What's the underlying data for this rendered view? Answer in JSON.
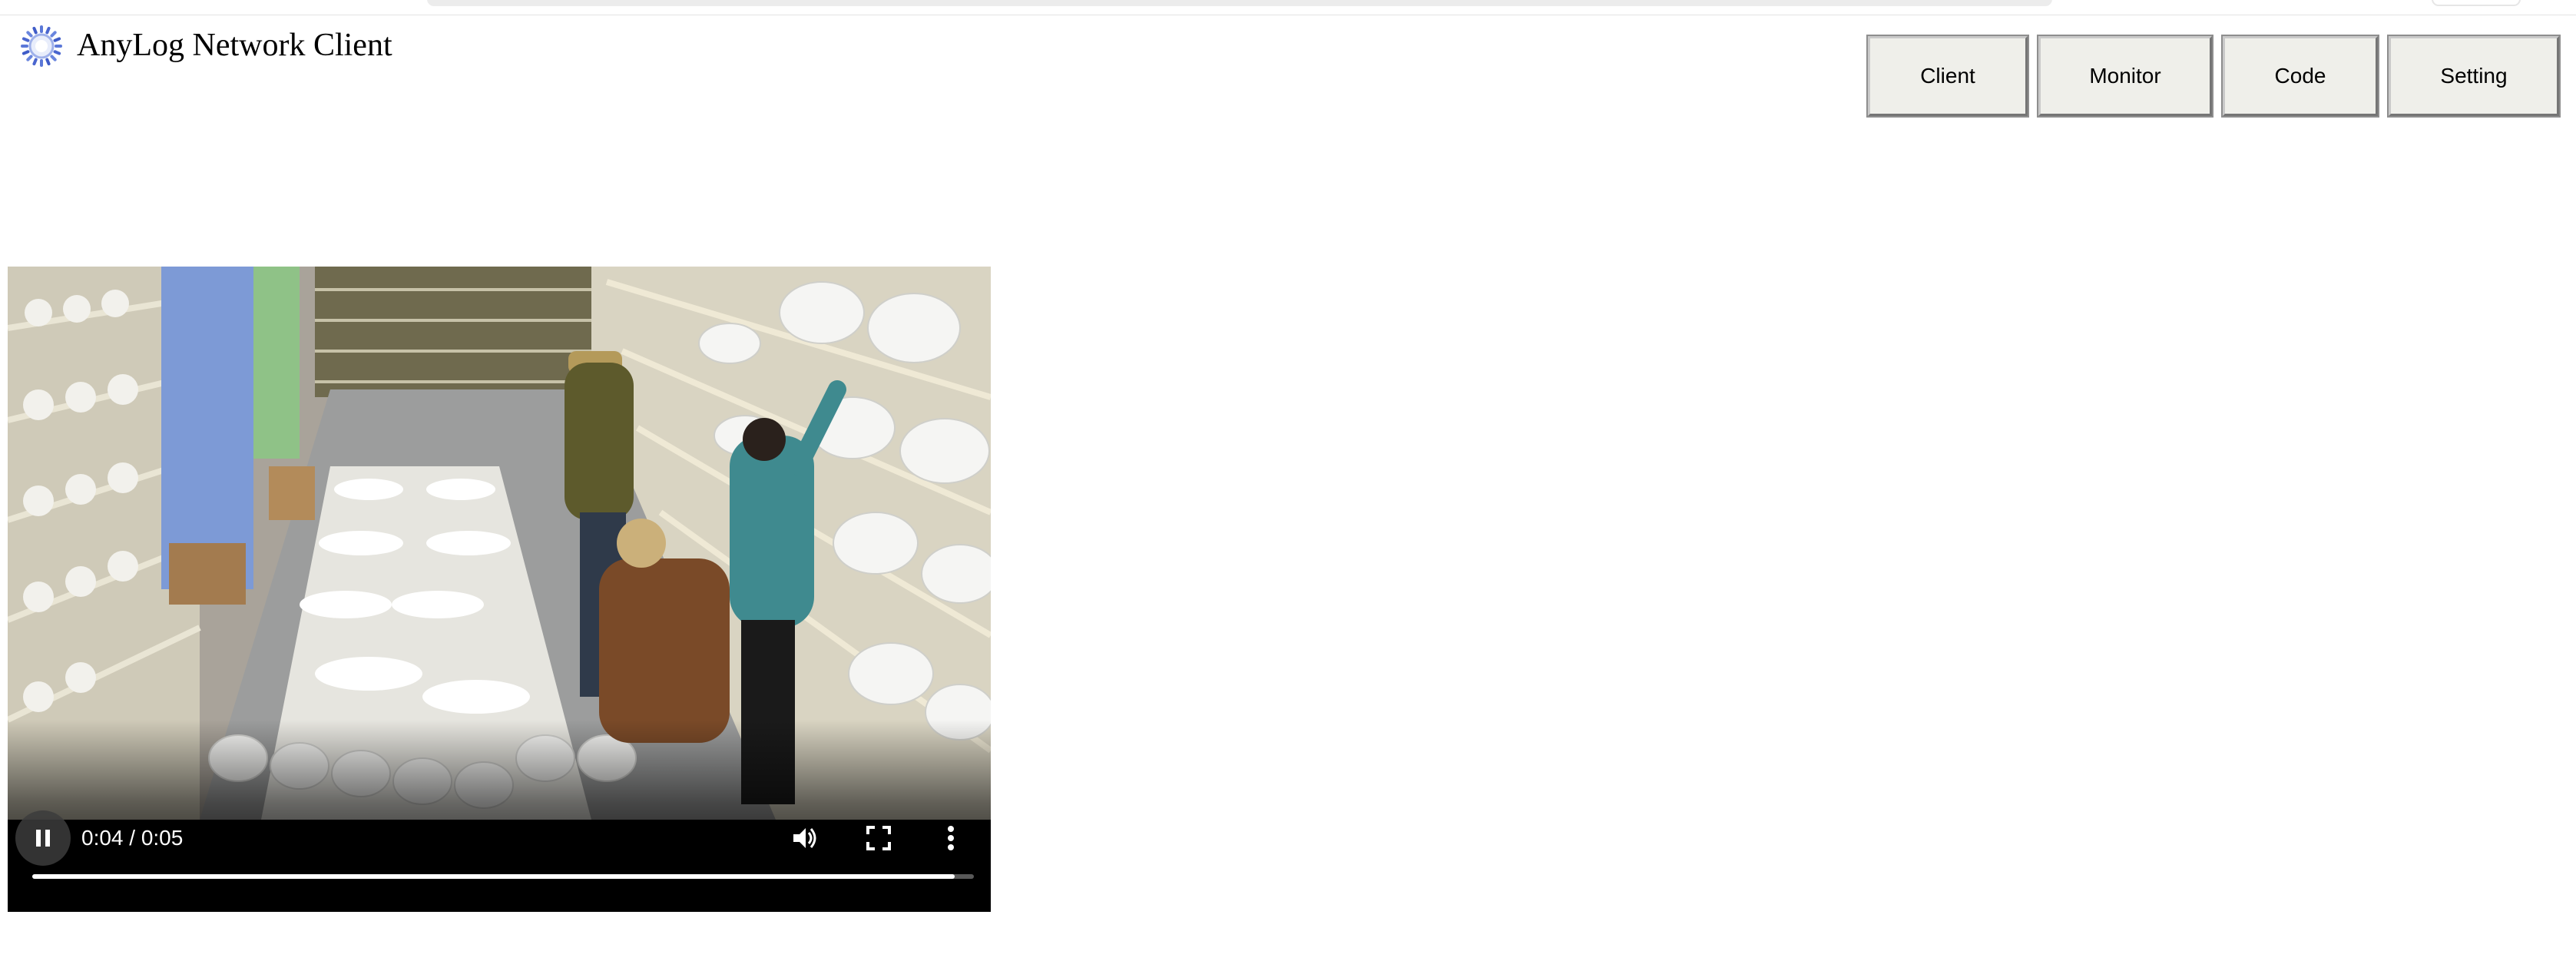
{
  "header": {
    "title": "AnyLog Network Client",
    "logo_icon": "anylog-logo-icon"
  },
  "nav": {
    "buttons": [
      {
        "label": "Client"
      },
      {
        "label": "Monitor"
      },
      {
        "label": "Code"
      },
      {
        "label": "Setting"
      }
    ]
  },
  "video": {
    "time_display": "0:04 / 0:05",
    "progress_fraction": 0.98,
    "state": "playing",
    "icons": {
      "play_pause": "pause-icon",
      "volume": "volume-icon",
      "fullscreen": "fullscreen-icon",
      "more": "more-options-icon"
    }
  },
  "colors": {
    "button_face": "#efefea",
    "logo_blue": "#3b5bcc"
  }
}
